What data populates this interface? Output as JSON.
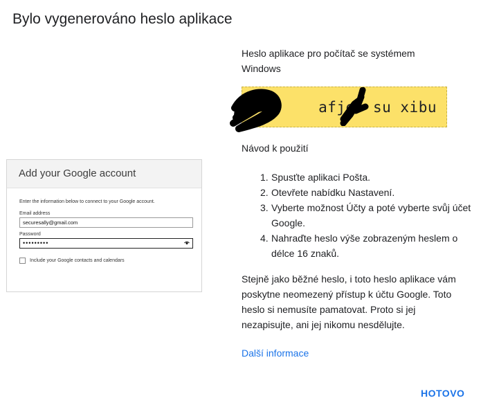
{
  "dialog": {
    "title": "Bylo vygenerováno heslo aplikace",
    "done_label": "HOTOVO"
  },
  "illustration": {
    "header": "Add your Google account",
    "instructions": "Enter the information below to connect to your Google account.",
    "email_label": "Email address",
    "email_value": "securesally@gmail.com",
    "password_label": "Password",
    "password_value": "•••••••••",
    "checkbox_label": "Include your Google contacts and calendars"
  },
  "password_panel": {
    "heading": "Heslo aplikace pro počítač se systémem Windows",
    "visible_password": "afje  su xibu"
  },
  "instructions": {
    "title": "Návod k použití",
    "steps": [
      {
        "num": "1.",
        "text": "Spusťte aplikaci Pošta."
      },
      {
        "num": "2.",
        "text": "Otevřete nabídku Nastavení."
      },
      {
        "num": "3.",
        "text": "Vyberte možnost Účty a poté vyberte svůj účet Google."
      },
      {
        "num": "4.",
        "text": "Nahraďte heslo výše zobrazeným heslem o délce 16 znaků."
      }
    ],
    "description": "Stejně jako běžné heslo, i toto heslo aplikace vám poskytne neomezený přístup k účtu Google. Toto heslo si nemusíte pamatovat. Proto si jej nezapisujte, ani jej nikomu nesdělujte.",
    "more_link": "Další informace"
  },
  "colors": {
    "accent": "#1a73e8",
    "password_bg": "#fce169"
  }
}
